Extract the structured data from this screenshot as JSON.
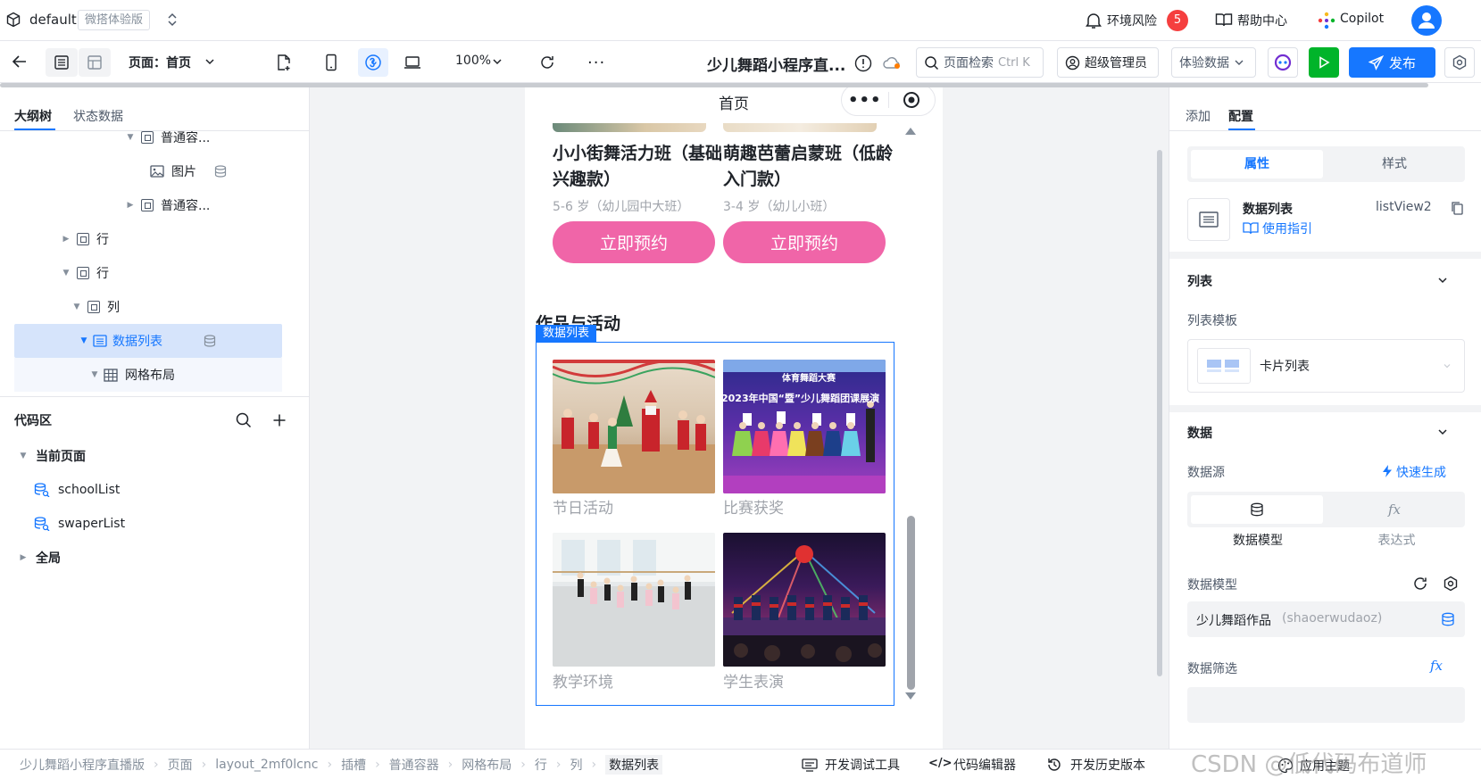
{
  "topbar": {
    "env_name": "default",
    "env_badge": "微搭体验版",
    "env_risk_label": "环境风险",
    "env_risk_count": "5",
    "help_label": "帮助中心",
    "copilot_label": "Copilot"
  },
  "toolbar": {
    "page_label": "页面：首页",
    "zoom": "100%",
    "app_title": "少儿舞蹈小程序直...",
    "search_placeholder": "页面检索",
    "search_shortcut": "Ctrl K",
    "admin_label": "超级管理员",
    "data_mode": "体验数据",
    "publish_label": "发布"
  },
  "left": {
    "tabs": [
      "大纲树",
      "状态数据"
    ],
    "tree": [
      {
        "label": "普通容...",
        "indent": 3,
        "expanded": true
      },
      {
        "label": "图片",
        "indent": 4
      },
      {
        "label": "普通容...",
        "indent": 3,
        "expanded": false
      },
      {
        "label": "行",
        "indent": 2,
        "expanded": false
      },
      {
        "label": "行",
        "indent": 2,
        "expanded": true
      },
      {
        "label": "列",
        "indent": 2,
        "expanded": true
      },
      {
        "label": "数据列表",
        "indent": 2,
        "expanded": true,
        "selected": true
      },
      {
        "label": "网格布局",
        "indent": 3,
        "expanded": true
      }
    ],
    "code_title": "代码区",
    "current_page": "当前页面",
    "code_items": [
      "schoolList",
      "swaperList"
    ],
    "global": "全局"
  },
  "canvas": {
    "nav_title": "首页",
    "courses": [
      {
        "title": "小小街舞活力班（基础兴趣款）",
        "sub": "5-6 岁（幼儿园中大班）",
        "btn": "立即预约"
      },
      {
        "title": "萌趣芭蕾启蒙班（低龄入门款）",
        "sub": "3-4 岁（幼儿小班）",
        "btn": "立即预约"
      }
    ],
    "section_title": "作品与活动",
    "selected_tag": "数据列表",
    "photos": [
      {
        "caption": "节日活动",
        "scene": "christmas"
      },
      {
        "caption": "比赛获奖",
        "scene": "award"
      },
      {
        "caption": "教学环境",
        "scene": "studio"
      },
      {
        "caption": "学生表演",
        "scene": "stage"
      }
    ],
    "award_banner_1": "2023年中国“暨”少儿舞蹈团课展演",
    "award_banner_0": "体育舞蹈大赛"
  },
  "right": {
    "tabs": [
      "添加",
      "配置"
    ],
    "seg": [
      "属性",
      "样式"
    ],
    "component_name": "数据列表",
    "component_id": "listView2",
    "guide_link": "使用指引",
    "list_section": "列表",
    "list_template_label": "列表模板",
    "list_template_value": "卡片列表",
    "data_section": "数据",
    "data_source_label": "数据源",
    "quick_gen": "快速生成",
    "source_options": [
      "数据模型",
      "表达式"
    ],
    "model_label": "数据模型",
    "model_value": "少儿舞蹈作品",
    "model_code": "(shaoerwudaoz)",
    "filter_label": "数据筛选"
  },
  "status": {
    "breadcrumbs": [
      "少儿舞蹈小程序直播版",
      "页面",
      "layout_2mf0lcnc",
      "插槽",
      "普通容器",
      "网格布局",
      "行",
      "列",
      "数据列表"
    ],
    "dev_tools": "开发调试工具",
    "code_editor": "代码编辑器",
    "history": "开发历史版本",
    "theme": "应用主题",
    "watermark": "CSDN @低代码布道师"
  },
  "colors": {
    "primary": "#1677ff",
    "pink": "#f065a8",
    "green": "#00b42a",
    "red": "#f53f3f"
  }
}
